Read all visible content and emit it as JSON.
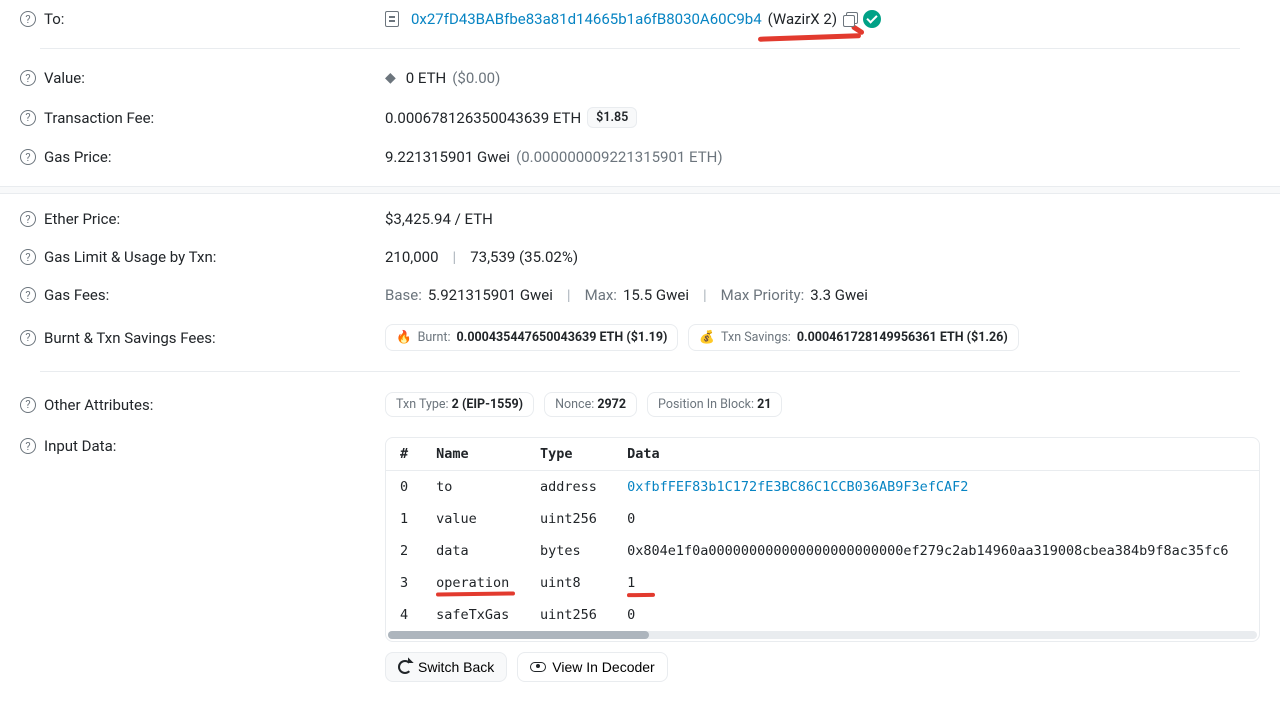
{
  "to": {
    "label": "To:",
    "address": "0x27fD43BABfbe83a81d14665b1a6fB8030A60C9b4",
    "name": "(WazirX 2)"
  },
  "value": {
    "label": "Value:",
    "amount": "0 ETH",
    "usd": "($0.00)"
  },
  "txnFee": {
    "label": "Transaction Fee:",
    "eth": "0.000678126350043639 ETH",
    "usd": "$1.85"
  },
  "gasPrice": {
    "label": "Gas Price:",
    "gwei": "9.221315901 Gwei",
    "eth": "(0.000000009221315901 ETH)"
  },
  "etherPrice": {
    "label": "Ether Price:",
    "value": "$3,425.94 / ETH"
  },
  "gasLimit": {
    "label": "Gas Limit & Usage by Txn:",
    "limit": "210,000",
    "used": "73,539 (35.02%)"
  },
  "gasFees": {
    "label": "Gas Fees:",
    "baseLabel": "Base:",
    "base": "5.921315901 Gwei",
    "maxLabel": "Max:",
    "max": "15.5 Gwei",
    "maxPriorityLabel": "Max Priority:",
    "maxPriority": "3.3 Gwei"
  },
  "burnt": {
    "label": "Burnt & Txn Savings Fees:",
    "burntLabel": "Burnt:",
    "burntValue": "0.000435447650043639 ETH ($1.19)",
    "savingsLabel": "Txn Savings:",
    "savingsValue": "0.000461728149956361 ETH ($1.26)"
  },
  "other": {
    "label": "Other Attributes:",
    "txnTypeLabel": "Txn Type:",
    "txnType": "2 (EIP-1559)",
    "nonceLabel": "Nonce:",
    "nonce": "2972",
    "posLabel": "Position In Block:",
    "pos": "21"
  },
  "inputData": {
    "label": "Input Data:",
    "headers": {
      "idx": "#",
      "name": "Name",
      "type": "Type",
      "data": "Data"
    },
    "rows": [
      {
        "idx": "0",
        "name": "to",
        "type": "address",
        "data": "0xfbfFEF83b1C172fE3BC86C1CCB036AB9F3efCAF2",
        "link": true
      },
      {
        "idx": "1",
        "name": "value",
        "type": "uint256",
        "data": "0"
      },
      {
        "idx": "2",
        "name": "data",
        "type": "bytes",
        "data": "0x804e1f0a000000000000000000000000ef279c2ab14960aa319008cbea384b9f8ac35fc6"
      },
      {
        "idx": "3",
        "name": "operation",
        "type": "uint8",
        "data": "1",
        "mark": true
      },
      {
        "idx": "4",
        "name": "safeTxGas",
        "type": "uint256",
        "data": "0"
      }
    ],
    "switchBack": "Switch Back",
    "viewDecoder": "View In Decoder"
  }
}
